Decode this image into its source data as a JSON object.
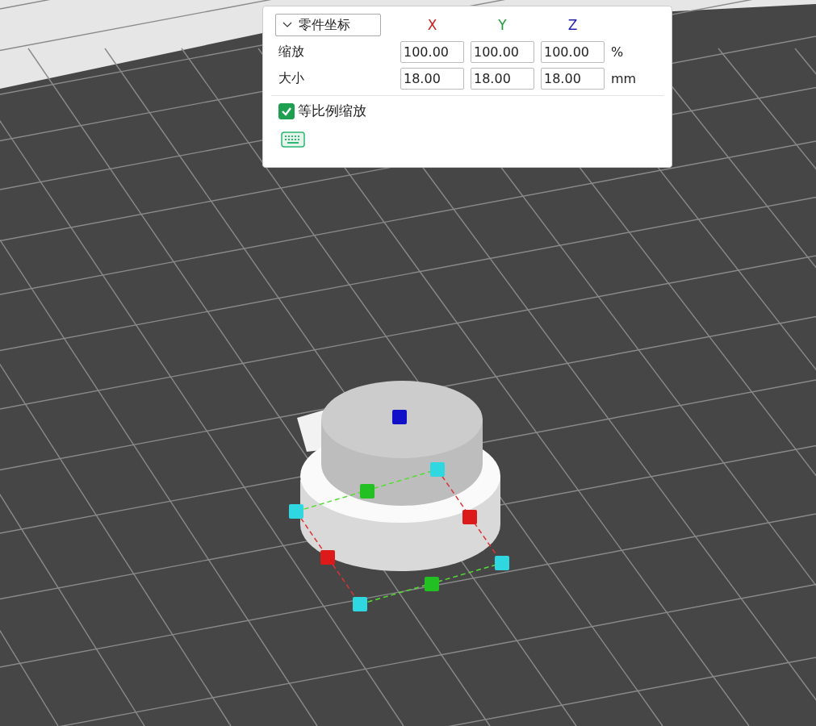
{
  "panel": {
    "coordinate_dropdown": {
      "label": "零件坐标",
      "expanded": false
    },
    "axes": [
      {
        "label": "X",
        "color": "#cc1f1f"
      },
      {
        "label": "Y",
        "color": "#1f9a3c"
      },
      {
        "label": "Z",
        "color": "#1f1fa8"
      }
    ],
    "rows": [
      {
        "label": "缩放",
        "values": [
          "100.00",
          "100.00",
          "100.00"
        ],
        "unit": "%"
      },
      {
        "label": "大小",
        "values": [
          "18.00",
          "18.00",
          "18.00"
        ],
        "unit": "mm"
      }
    ],
    "uniform_scale": {
      "label": "等比例缩放",
      "checked": true
    }
  }
}
